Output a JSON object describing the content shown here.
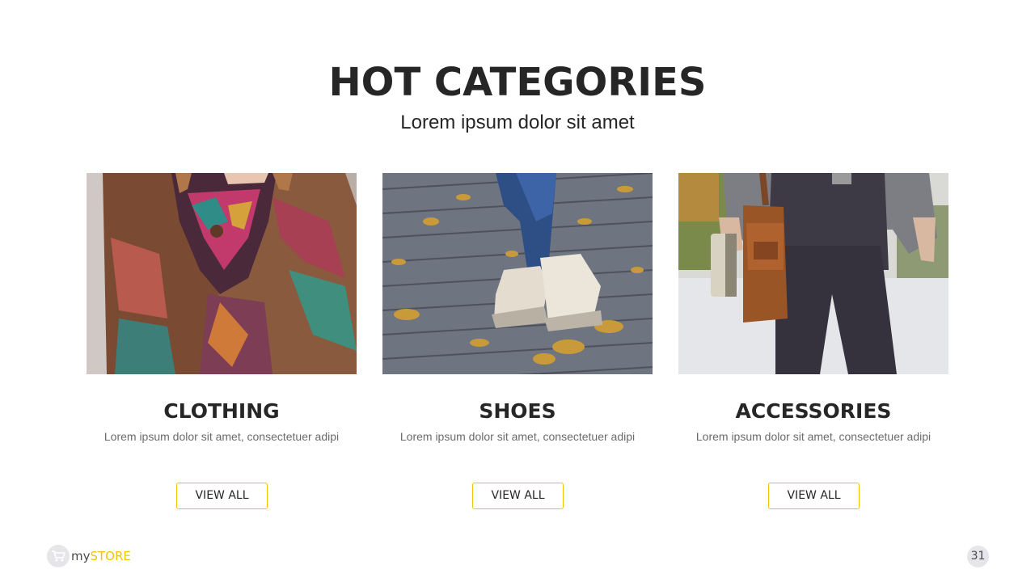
{
  "header": {
    "title": "HOT CATEGORIES",
    "subtitle": "Lorem ipsum dolor sit amet"
  },
  "categories": [
    {
      "title": "CLOTHING",
      "description": "Lorem ipsum dolor sit amet, consectetuer adipi",
      "button_label": "VIEW ALL",
      "image_subject": "woman-in-patterned-blanket-coat"
    },
    {
      "title": "SHOES",
      "description": "Lorem ipsum dolor sit amet, consectetuer adipi",
      "button_label": "VIEW ALL",
      "image_subject": "boots-on-brick-pavement-with-leaves"
    },
    {
      "title": "ACCESSORIES",
      "description": "Lorem ipsum dolor sit amet, consectetuer adipi",
      "button_label": "VIEW ALL",
      "image_subject": "man-with-leather-bag-and-book"
    }
  ],
  "footer": {
    "brand_prefix": "my",
    "brand_suffix": "STORE",
    "brand_icon": "shopping-cart-icon",
    "page_number": "31"
  },
  "colors": {
    "accent": "#f2c400",
    "title": "#262626",
    "body_text": "#6b6b6b",
    "badge_bg": "#e6e6ea"
  }
}
